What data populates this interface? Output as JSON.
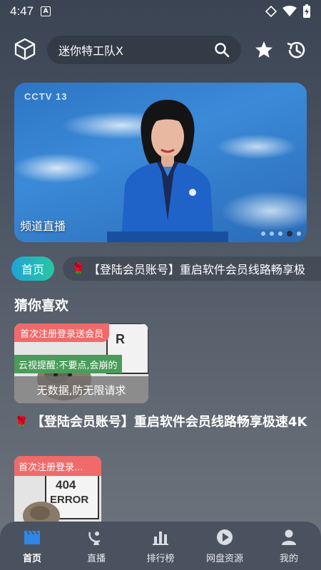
{
  "status_bar": {
    "time": "4:47",
    "notification_letter": "A"
  },
  "header": {
    "search": {
      "value": "迷你特工队X"
    }
  },
  "banner": {
    "channel_logo": "CCTV 13",
    "label": "频道直播",
    "slides": 5,
    "active_slide": 4
  },
  "notice": {
    "home_chip": "首页",
    "marquee_text": "【登陆会员账号】重启软件会员线路畅享极"
  },
  "recommend": {
    "title": "猜你喜欢",
    "card1": {
      "tag_top": "首次注册登录送会员",
      "tag_mid": "云视提醒:不要点,会崩的",
      "bottom_text": "无数据,防无限请求"
    },
    "item_title": "【登陆会员账号】重启软件会员线路畅享极速4K",
    "card2": {
      "tag_top": "首次注册登录...",
      "img_text_top": "404",
      "img_text_bottom": "ERROR"
    }
  },
  "nav": {
    "items": [
      {
        "label": "首页",
        "icon": "clapperboard-icon",
        "active": true
      },
      {
        "label": "直播",
        "icon": "satellite-dish-icon",
        "active": false
      },
      {
        "label": "排行榜",
        "icon": "bar-chart-icon",
        "active": false
      },
      {
        "label": "网盘资源",
        "icon": "play-circle-icon",
        "active": false
      },
      {
        "label": "我的",
        "icon": "person-icon",
        "active": false
      }
    ]
  }
}
